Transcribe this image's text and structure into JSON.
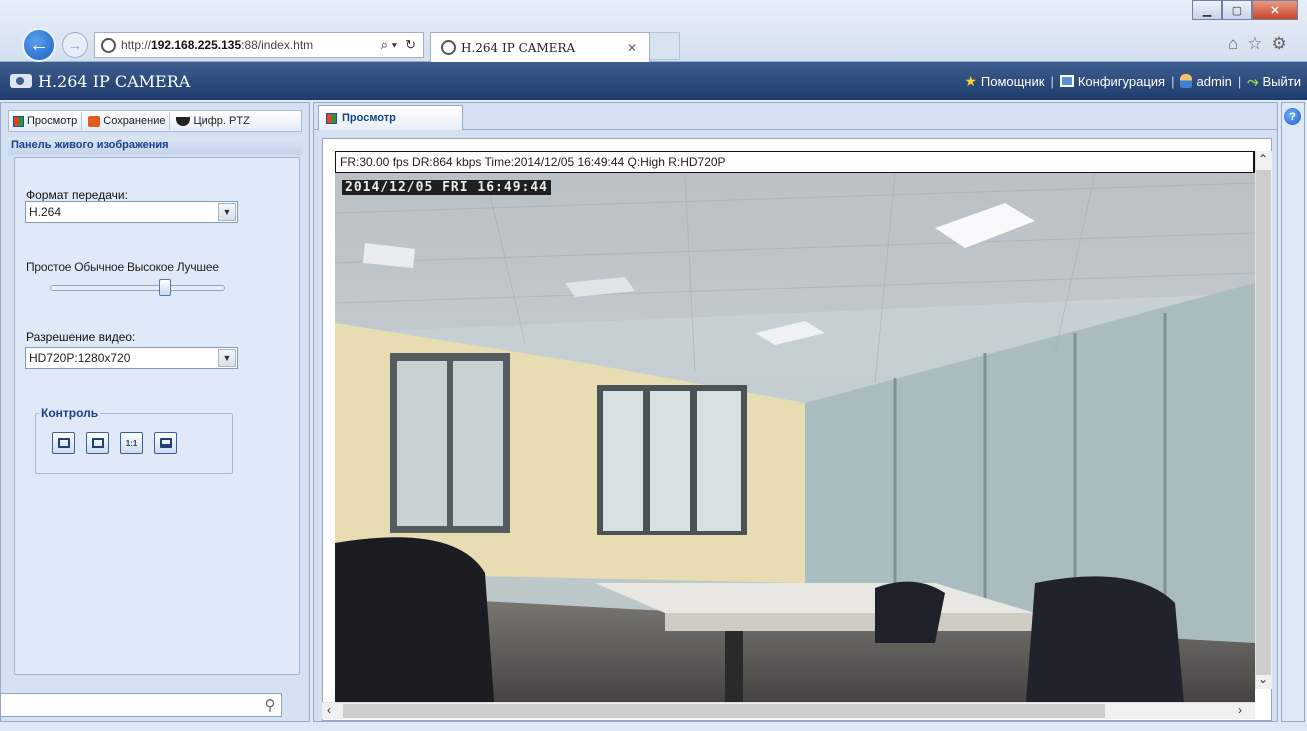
{
  "browser": {
    "url_prefix": "http://",
    "url_host": "192.168.225.135",
    "url_rest": ":88/index.htm",
    "tab_title": "H.264 IP CAMERA",
    "search_glyph": "⌕ ▾",
    "refresh_glyph": "↻"
  },
  "app": {
    "title": "H.264 IP CAMERA",
    "nav": {
      "helper": "Помощник",
      "config": "Конфигурация",
      "user": "admin",
      "logout": "Выйти"
    }
  },
  "left": {
    "tabs": [
      "Просмотр",
      "Сохранение",
      "Цифр. PTZ"
    ],
    "panel_title": "Панель живого изображения",
    "format_label": "Формат передачи:",
    "format_value": "H.264",
    "quality_labels": [
      "Простое",
      "Обычное",
      "Высокое",
      "Лучшее"
    ],
    "quality_level": 0.67,
    "resolution_label": "Разрешение видео:",
    "resolution_value": "HD720P:1280x720",
    "control_title": "Контроль",
    "control_buttons": [
      "snapshot-icon",
      "fullscreen-icon",
      "actual-size-icon",
      "fit-window-icon"
    ],
    "one_to_one_label": "1:1",
    "search_value": ""
  },
  "main": {
    "tab_label": "Просмотр",
    "info": "FR:30.00 fps  DR:864 kbps Time:2014/12/05 16:49:44 Q:High R:HD720P",
    "osd": "2014/12/05 FRI 16:49:44"
  },
  "colors": {
    "appbar": "#2a4a7c",
    "panel": "#d4e1f2",
    "accent": "#15428b"
  }
}
